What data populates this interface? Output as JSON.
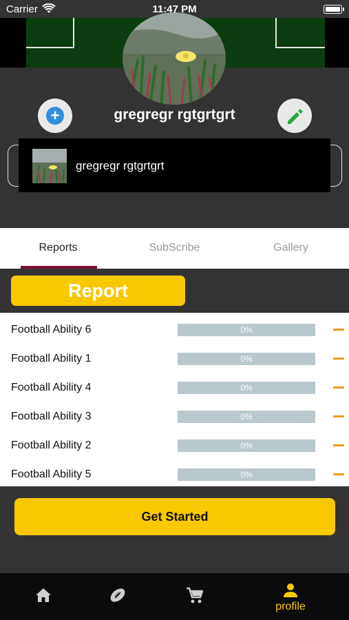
{
  "status_bar": {
    "carrier": "Carrier",
    "time": "11:47 PM"
  },
  "profile": {
    "name": "gregregr rgtgrtgrt"
  },
  "suggestion": {
    "label": "gregregr rgtgrtgrt"
  },
  "tabs": [
    {
      "label": "Reports",
      "active": true
    },
    {
      "label": "SubScribe",
      "active": false
    },
    {
      "label": "Gallery",
      "active": false
    }
  ],
  "report": {
    "label": "Report"
  },
  "abilities": [
    {
      "name": "Football Ability 6",
      "progress": "0%",
      "value": 0
    },
    {
      "name": "Football Ability 1",
      "progress": "0%",
      "value": 0
    },
    {
      "name": "Football Ability 4",
      "progress": "0%",
      "value": 0
    },
    {
      "name": "Football Ability 3",
      "progress": "0%",
      "value": 0
    },
    {
      "name": "Football Ability 2",
      "progress": "0%",
      "value": 0
    },
    {
      "name": "Football Ability 5",
      "progress": "0%",
      "value": 0
    }
  ],
  "cta": {
    "label": "Get Started"
  },
  "bottom_nav": [
    {
      "icon": "home-icon",
      "label": ""
    },
    {
      "icon": "football-icon",
      "label": ""
    },
    {
      "icon": "cart-icon",
      "label": ""
    },
    {
      "icon": "person-icon",
      "label": "profile",
      "active": true
    }
  ],
  "colors": {
    "accent": "#f8c803",
    "tab_indicator": "#7a1030",
    "progress_track": "#b9c8cd",
    "minus": "#f39a1c"
  }
}
